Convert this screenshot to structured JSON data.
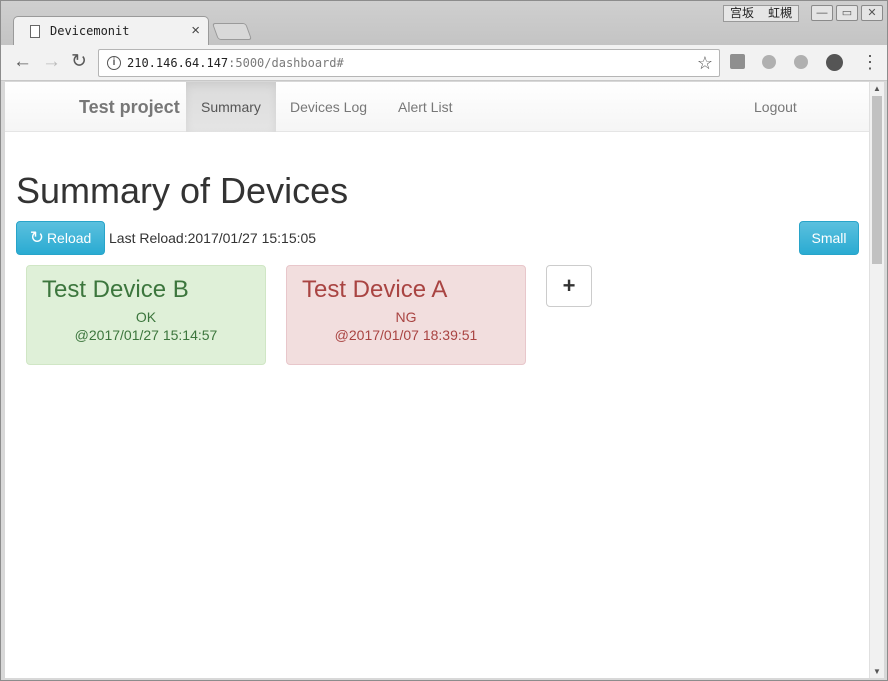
{
  "browser": {
    "tab_title": "Devicemonit",
    "tab_close": "×",
    "ime_labels": [
      "宫坂",
      "虹槻"
    ],
    "url_host": "210.146.64.147",
    "url_rest": ":5000/dashboard#",
    "info_glyph": "i",
    "star_glyph": "☆",
    "back_glyph": "←",
    "forward_glyph": "→",
    "reload_glyph": "↻",
    "menu_glyph": "⋮",
    "minimize_glyph": "—",
    "restore_glyph": "▭",
    "close_glyph": "✕"
  },
  "navbar": {
    "brand": "Test project",
    "items": [
      {
        "label": "Summary",
        "active": true
      },
      {
        "label": "Devices Log",
        "active": false
      },
      {
        "label": "Alert List",
        "active": false
      }
    ],
    "logout": "Logout"
  },
  "main": {
    "title": "Summary of Devices",
    "reload_label": "Reload",
    "reload_icon": "↻",
    "last_reload": "Last Reload:2017/01/27 15:15:05",
    "small_label": "Small",
    "add_label": "+"
  },
  "devices": [
    {
      "name": "Test Device B",
      "status": "OK",
      "time": "@2017/01/27 15:14:57",
      "state": "ok"
    },
    {
      "name": "Test Device A",
      "status": "NG",
      "time": "@2017/01/07 18:39:51",
      "state": "ng"
    }
  ],
  "colors": {
    "ok_bg": "#dff0d8",
    "ok_text": "#3c763d",
    "ng_bg": "#f2dede",
    "ng_text": "#a94442",
    "info_button": "#31b0d5"
  }
}
